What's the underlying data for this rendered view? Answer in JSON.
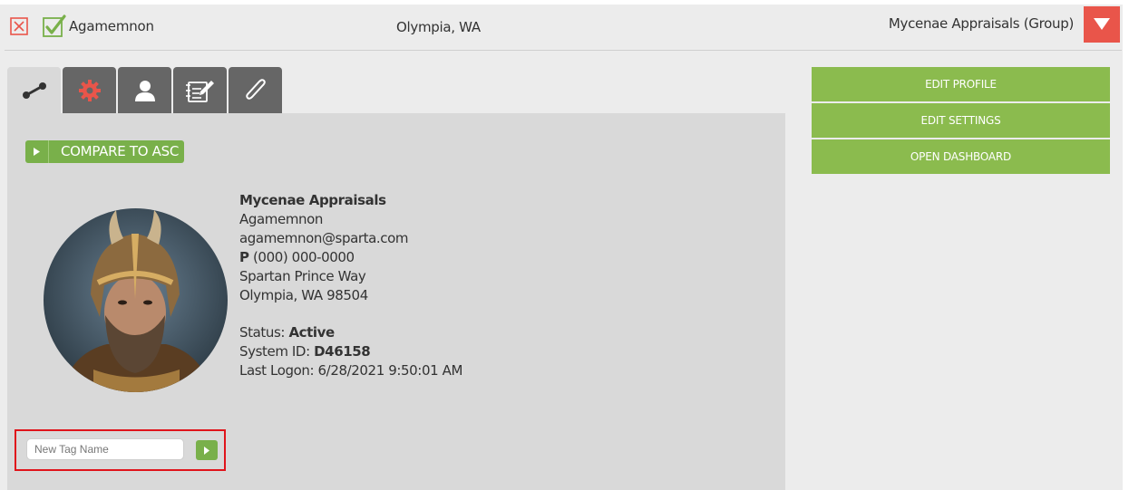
{
  "header": {
    "name": "Agamemnon",
    "location": "Olympia, WA",
    "group": "Mycenae Appraisals (Group)"
  },
  "tabs": [
    {
      "icon": "connection-icon",
      "active": true
    },
    {
      "icon": "gear-icon",
      "active": false
    },
    {
      "icon": "person-icon",
      "active": false
    },
    {
      "icon": "notes-icon",
      "active": false
    },
    {
      "icon": "paperclip-icon",
      "active": false
    }
  ],
  "compare_label": "COMPARE TO ASC",
  "profile": {
    "company": "Mycenae Appraisals",
    "name": "Agamemnon",
    "email": "agamemnon@sparta.com",
    "phone_label": "P",
    "phone": "(000) 000-0000",
    "street": "Spartan Prince Way",
    "city": "Olympia, WA 98504",
    "status_label": "Status:",
    "status": "Active",
    "system_id_label": "System ID:",
    "system_id": "D46158",
    "last_logon_label": "Last Logon:",
    "last_logon": "6/28/2021 9:50:01 AM"
  },
  "tag": {
    "placeholder": "New Tag Name"
  },
  "actions": {
    "edit_profile": "EDIT PROFILE",
    "edit_settings": "EDIT SETTINGS",
    "open_dashboard": "OPEN DASHBOARD"
  },
  "colors": {
    "green": "#8bbb4e",
    "red": "#e9554a",
    "highlight": "#e0141b"
  }
}
